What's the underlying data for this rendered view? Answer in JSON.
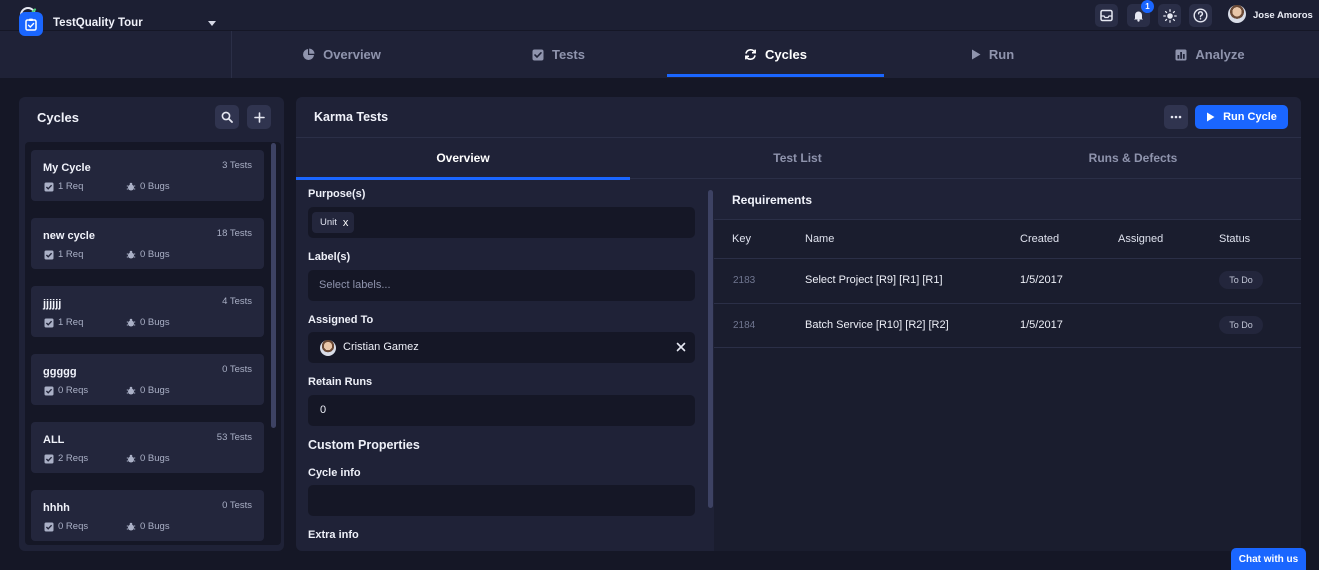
{
  "topbar": {
    "user_name": "Jose Amoros",
    "notification_count": "1"
  },
  "project": {
    "name": "TestQuality Tour"
  },
  "nav": {
    "tabs": [
      {
        "label": "Overview",
        "icon": "pie-chart-icon"
      },
      {
        "label": "Tests",
        "icon": "checkbox-icon"
      },
      {
        "label": "Cycles",
        "icon": "refresh-icon"
      },
      {
        "label": "Run",
        "icon": "play-icon"
      },
      {
        "label": "Analyze",
        "icon": "bar-chart-icon"
      }
    ],
    "active": "Cycles"
  },
  "cycles_panel": {
    "title": "Cycles",
    "items": [
      {
        "name": "My Cycle",
        "tests": "3 Tests",
        "reqs": "1 Req",
        "bugs": "0 Bugs"
      },
      {
        "name": "new cycle",
        "tests": "18 Tests",
        "reqs": "1 Req",
        "bugs": "0 Bugs"
      },
      {
        "name": "jjjjjj",
        "tests": "4 Tests",
        "reqs": "1 Req",
        "bugs": "0 Bugs"
      },
      {
        "name": "ggggg",
        "tests": "0 Tests",
        "reqs": "0 Reqs",
        "bugs": "0 Bugs"
      },
      {
        "name": "ALL",
        "tests": "53 Tests",
        "reqs": "2 Reqs",
        "bugs": "0 Bugs"
      },
      {
        "name": "hhhh",
        "tests": "0 Tests",
        "reqs": "0 Reqs",
        "bugs": "0 Bugs"
      }
    ]
  },
  "main": {
    "title": "Karma Tests",
    "run_button": "Run Cycle",
    "tabs": [
      "Overview",
      "Test List",
      "Runs & Defects"
    ],
    "active_tab": "Overview"
  },
  "form": {
    "purpose_label": "Purpose(s)",
    "purpose_chip": "Unit",
    "chip_remove": "x",
    "labels_label": "Label(s)",
    "labels_placeholder": "Select labels...",
    "assigned_label": "Assigned To",
    "assigned_value": "Cristian Gamez",
    "retain_label": "Retain Runs",
    "retain_value": "0",
    "custom_title": "Custom Properties",
    "cycle_info_label": "Cycle info",
    "cycle_info_value": "",
    "extra_info_label": "Extra info"
  },
  "requirements": {
    "title": "Requirements",
    "columns": [
      "Key",
      "Name",
      "Created",
      "Assigned",
      "Status"
    ],
    "rows": [
      {
        "key": "2183",
        "name": "Select Project [R9] [R1] [R1]",
        "created": "1/5/2017",
        "assigned": "",
        "status": "To Do"
      },
      {
        "key": "2184",
        "name": "Batch Service [R10] [R2] [R2]",
        "created": "1/5/2017",
        "assigned": "",
        "status": "To Do"
      }
    ]
  },
  "chat": {
    "label": "Chat with us"
  },
  "colors": {
    "accent": "#1a66ff",
    "background": "#151726",
    "panel": "#1f2237"
  }
}
